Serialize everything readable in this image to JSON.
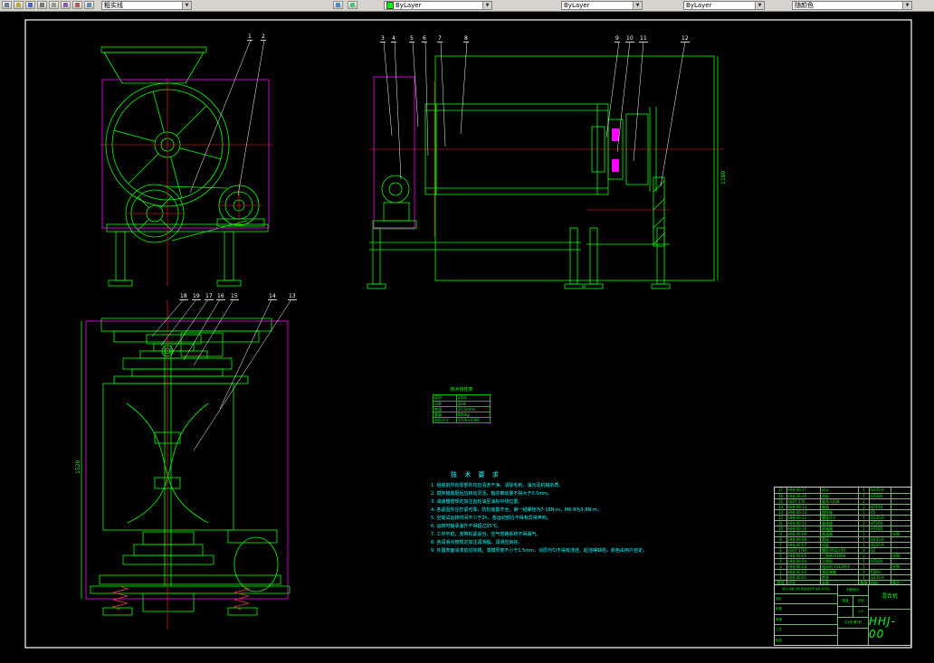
{
  "toolbar": {
    "icons": [
      "new-file-icon",
      "open-file-icon",
      "save-icon",
      "print-icon",
      "print-preview-icon",
      "find-icon",
      "cut-icon",
      "copy-icon",
      "paste-icon",
      "undo-icon",
      "redo-icon",
      "zoom-window-icon",
      "zoom-realtime-icon"
    ],
    "combos": [
      {
        "label": "粗实线"
      },
      {
        "label": "ByLayer",
        "swatch": "#00ff00"
      },
      {
        "label": "ByLayer"
      },
      {
        "label": "ByLayer"
      },
      {
        "label": "随颜色"
      }
    ]
  },
  "colors": {
    "line": "#00ff00",
    "center": "#ff2a2a",
    "guard": "#ff00ff",
    "note": "#00ffff",
    "leader": "#ffffff"
  },
  "callouts": {
    "front": [
      "1",
      "2"
    ],
    "side": [
      "3",
      "4",
      "5",
      "6",
      "7",
      "8"
    ],
    "drive": [
      "9",
      "10",
      "11",
      "12"
    ],
    "bottom": [
      "18",
      "19",
      "17",
      "16",
      "15",
      "14",
      "13"
    ]
  },
  "dims": {
    "side_height": "1180",
    "view_height": "1520"
  },
  "tech_table": {
    "title": "技术特性表",
    "rows": [
      [
        "容积",
        "250L"
      ],
      [
        "功率",
        "4kW"
      ],
      [
        "转速",
        "35.5r/min"
      ],
      [
        "重量",
        "600kg"
      ],
      [
        "外形尺寸",
        "1700×1060"
      ]
    ]
  },
  "tech_req": {
    "title": "技 术 要 求",
    "lines": [
      "1. 组装前所有零部件均应清洗干净，清除毛刺、油污及机械杂质。",
      "2. 搅拌轴装配后应转动灵活，轴向窜动量不得大于0.5mm。",
      "3. 减速器按规定加注齿轮油至油标中线位置。",
      "4. 各紧固件应拧紧可靠，防松装置齐全，第一组螺栓为7-16N·m，M6-8为3-8N·m。",
      "5. 空载试运转时间不少于2h，各运动部位不得有异常声响。",
      "6. 运转时轴承温升不得超过35℃。",
      "7. 工作平稳，皮带松紧适当，空气管路系统不得漏气。",
      "8. 各润滑点按规定加注润滑脂，润滑应良好。",
      "9. 外露表面涂漆前应除锈，漆膜厚度不小于1.5mm，涂层均匀不得有流挂、起泡等缺陷，颜色由用户自定。"
    ]
  },
  "bom": {
    "headers": [
      "序号",
      "代号",
      "名称",
      "数量",
      "材料",
      "备注"
    ],
    "rows": [
      [
        "17",
        "HHJ-00-17",
        "料斗",
        "1",
        "Q235-A",
        ""
      ],
      [
        "16",
        "HHJ-00-16",
        "带轮",
        "1",
        "HT200",
        ""
      ],
      [
        "15",
        "GB/T 276",
        "轴承 6208",
        "2",
        "",
        ""
      ],
      [
        "14",
        "HHJ-00-14",
        "端盖",
        "2",
        "HT150",
        ""
      ],
      [
        "13",
        "HHJ-00-13",
        "搅拌轴",
        "1",
        "45",
        ""
      ],
      [
        "12",
        "HHJ-00-12",
        "螺旋叶片",
        "1",
        "Q235-A",
        ""
      ],
      [
        "11",
        "HHJ-00-11",
        "轴承座",
        "2",
        "HT200",
        ""
      ],
      [
        "10",
        "HHJ-00-10",
        "联轴器",
        "1",
        "HT200",
        ""
      ],
      [
        "9",
        "HHJ-00-09",
        "减速器",
        "1",
        "",
        "外购"
      ],
      [
        "8",
        "HHJ-00-08",
        "筒体",
        "1",
        "Q235-A",
        ""
      ],
      [
        "7",
        "HHJ-00-07",
        "机架",
        "1",
        "Q235-A",
        ""
      ],
      [
        "6",
        "GB/T 5781",
        "螺栓 M12×40",
        "8",
        "35",
        ""
      ],
      [
        "5",
        "HHJ-00-05",
        "三角带 B1800",
        "2",
        "",
        "外购"
      ],
      [
        "4",
        "HHJ-00-04",
        "大带轮",
        "1",
        "HT200",
        ""
      ],
      [
        "3",
        "HHJ-00-03",
        "电动机 Y112M-4",
        "1",
        "",
        "外购"
      ],
      [
        "2",
        "HHJ-00-02",
        "减振弹簧",
        "4",
        "65Mn",
        ""
      ],
      [
        "1",
        "HHJ-00-01",
        "底座",
        "1",
        "Q235-A",
        ""
      ]
    ]
  },
  "title_block": {
    "sig_header": "标记 处数 分区 更改文件号 签名 年月日",
    "sig_rows": [
      "设计",
      "校核",
      "审核",
      "工艺",
      "批准"
    ],
    "stage_label": "阶段标记",
    "weight_label": "重量",
    "scale_label": "比例",
    "scale_value": "1:5",
    "sheet_info": "共1张 第1张",
    "product_name": "混合机",
    "drawing_no": "HHJ-00"
  }
}
